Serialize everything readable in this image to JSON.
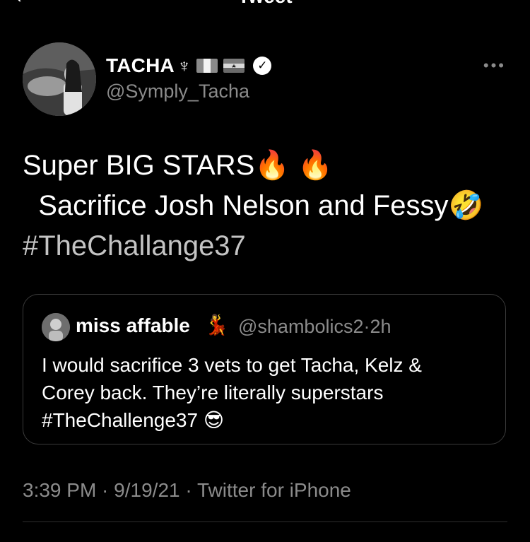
{
  "header": {
    "title": "Tweet",
    "back_icon": "back-arrow-icon"
  },
  "author": {
    "display_name": "TACHA",
    "name_symbol": "♆",
    "flags": [
      "nigeria-flag",
      "ghana-flag"
    ],
    "verified_icon": "verified-badge-icon",
    "handle": "@Symply_Tacha"
  },
  "tweet": {
    "line1": "Super BIG STARS",
    "line1_emoji": "🔥 🔥",
    "line2": "Sacrifice Josh Nelson and Fessy",
    "line2_emoji": "🤣",
    "hashtag": "#TheChallange37"
  },
  "quote": {
    "name": "miss affable",
    "name_emoji": "💃",
    "handle": "@shambolics2",
    "separator": "·",
    "time": "2h",
    "line1": "I would sacrifice 3 vets to get Tacha, Kelz &",
    "line2": "Corey back. They’re literally superstars",
    "line3": "#TheChallenge37",
    "line3_emoji": "😎"
  },
  "meta": {
    "time": "3:39 PM",
    "sep1": " · ",
    "date": "9/19/21",
    "sep2": " · ",
    "source": "Twitter for iPhone"
  }
}
